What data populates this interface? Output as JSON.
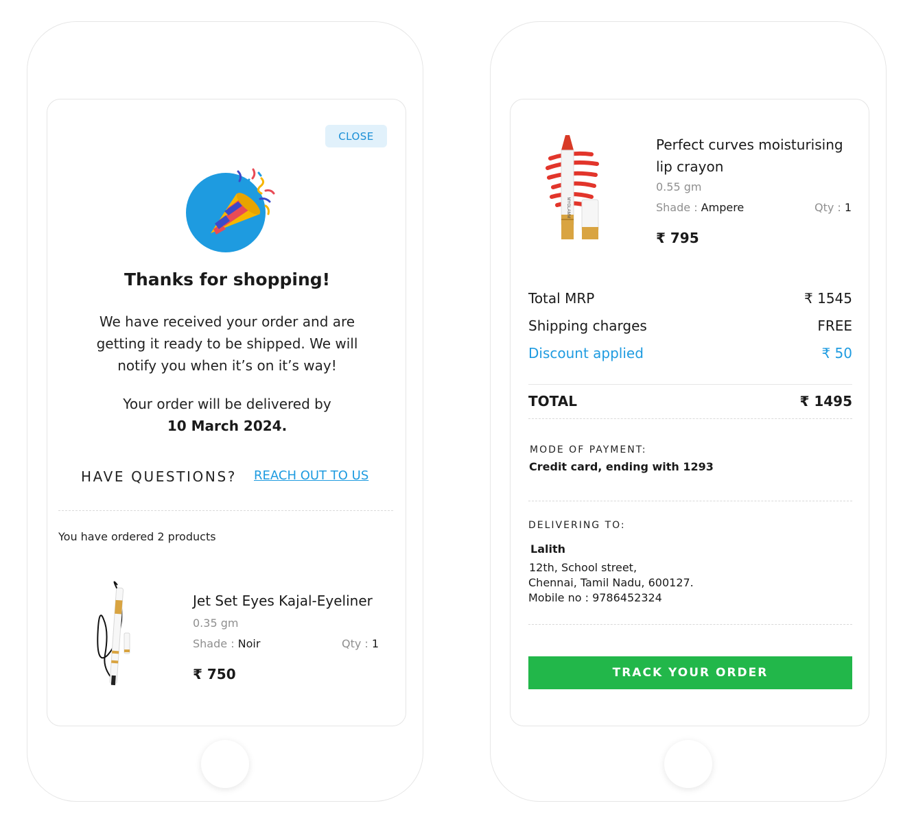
{
  "colors": {
    "accent_blue": "#1e9be0",
    "close_bg": "#e1f1fb",
    "track_green": "#22b74a",
    "muted": "#8f8f8f"
  },
  "confirmation": {
    "close_label": "CLOSE",
    "title": "Thanks for shopping!",
    "message": "We have received your order and are getting it ready to be shipped. We will notify you when it’s on it’s way!",
    "delivery_prefix": "Your order will be delivered by",
    "delivery_date": "10 March 2024.",
    "questions_label": "HAVE QUESTIONS?",
    "reach_out_label": "REACH OUT TO US",
    "ordered_count_text": "You have ordered 2 products"
  },
  "products": [
    {
      "name": "Jet Set Eyes Kajal-Eyeliner",
      "weight": "0.35 gm",
      "shade_label": "Shade :",
      "shade_value": "Noir",
      "qty_label": "Qty :",
      "qty_value": "1",
      "price": "₹ 750"
    },
    {
      "name": "Perfect curves moisturising lip crayon",
      "weight": "0.55 gm",
      "shade_label": "Shade :",
      "shade_value": "Ampere",
      "qty_label": "Qty :",
      "qty_value": "1",
      "price": "₹ 795",
      "brand_text": "MYGLAMM"
    }
  ],
  "summary": {
    "total_mrp_label": "Total MRP",
    "total_mrp_value": "₹ 1545",
    "shipping_label": "Shipping charges",
    "shipping_value": "FREE",
    "discount_label": "Discount applied",
    "discount_value": "₹ 50",
    "total_label": "TOTAL",
    "total_value": "₹ 1495"
  },
  "payment": {
    "label": "MODE OF PAYMENT:",
    "value": "Credit card, ending with 1293"
  },
  "delivery": {
    "label": "DELIVERING TO:",
    "name": "Lalith",
    "address_line1": "12th, School street,",
    "address_line2": "Chennai, Tamil Nadu, 600127.",
    "mobile": "Mobile no : 9786452324"
  },
  "track_label": "TRACK YOUR ORDER"
}
